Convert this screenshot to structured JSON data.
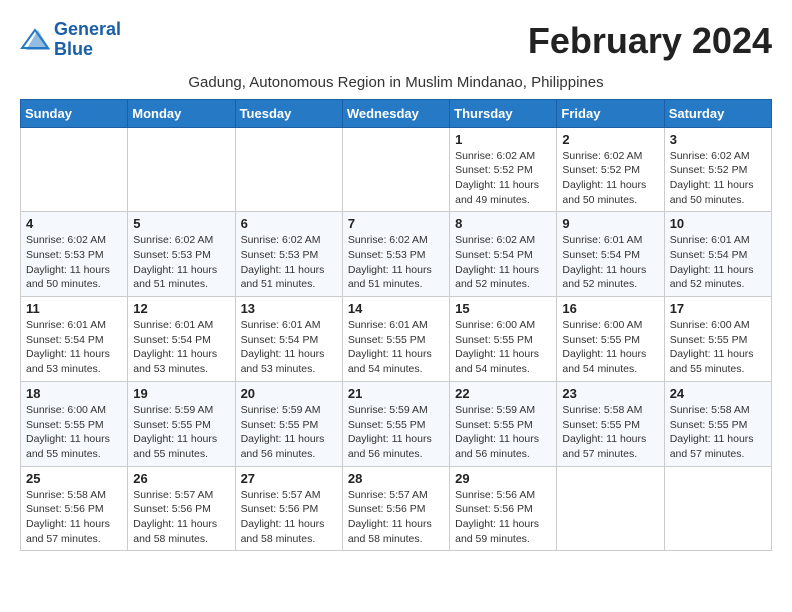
{
  "logo": {
    "line1": "General",
    "line2": "Blue"
  },
  "title": "February 2024",
  "subtitle": "Gadung, Autonomous Region in Muslim Mindanao, Philippines",
  "header": {
    "days": [
      "Sunday",
      "Monday",
      "Tuesday",
      "Wednesday",
      "Thursday",
      "Friday",
      "Saturday"
    ]
  },
  "weeks": [
    [
      {
        "day": "",
        "info": ""
      },
      {
        "day": "",
        "info": ""
      },
      {
        "day": "",
        "info": ""
      },
      {
        "day": "",
        "info": ""
      },
      {
        "day": "1",
        "info": "Sunrise: 6:02 AM\nSunset: 5:52 PM\nDaylight: 11 hours and 49 minutes."
      },
      {
        "day": "2",
        "info": "Sunrise: 6:02 AM\nSunset: 5:52 PM\nDaylight: 11 hours and 50 minutes."
      },
      {
        "day": "3",
        "info": "Sunrise: 6:02 AM\nSunset: 5:52 PM\nDaylight: 11 hours and 50 minutes."
      }
    ],
    [
      {
        "day": "4",
        "info": "Sunrise: 6:02 AM\nSunset: 5:53 PM\nDaylight: 11 hours and 50 minutes."
      },
      {
        "day": "5",
        "info": "Sunrise: 6:02 AM\nSunset: 5:53 PM\nDaylight: 11 hours and 51 minutes."
      },
      {
        "day": "6",
        "info": "Sunrise: 6:02 AM\nSunset: 5:53 PM\nDaylight: 11 hours and 51 minutes."
      },
      {
        "day": "7",
        "info": "Sunrise: 6:02 AM\nSunset: 5:53 PM\nDaylight: 11 hours and 51 minutes."
      },
      {
        "day": "8",
        "info": "Sunrise: 6:02 AM\nSunset: 5:54 PM\nDaylight: 11 hours and 52 minutes."
      },
      {
        "day": "9",
        "info": "Sunrise: 6:01 AM\nSunset: 5:54 PM\nDaylight: 11 hours and 52 minutes."
      },
      {
        "day": "10",
        "info": "Sunrise: 6:01 AM\nSunset: 5:54 PM\nDaylight: 11 hours and 52 minutes."
      }
    ],
    [
      {
        "day": "11",
        "info": "Sunrise: 6:01 AM\nSunset: 5:54 PM\nDaylight: 11 hours and 53 minutes."
      },
      {
        "day": "12",
        "info": "Sunrise: 6:01 AM\nSunset: 5:54 PM\nDaylight: 11 hours and 53 minutes."
      },
      {
        "day": "13",
        "info": "Sunrise: 6:01 AM\nSunset: 5:54 PM\nDaylight: 11 hours and 53 minutes."
      },
      {
        "day": "14",
        "info": "Sunrise: 6:01 AM\nSunset: 5:55 PM\nDaylight: 11 hours and 54 minutes."
      },
      {
        "day": "15",
        "info": "Sunrise: 6:00 AM\nSunset: 5:55 PM\nDaylight: 11 hours and 54 minutes."
      },
      {
        "day": "16",
        "info": "Sunrise: 6:00 AM\nSunset: 5:55 PM\nDaylight: 11 hours and 54 minutes."
      },
      {
        "day": "17",
        "info": "Sunrise: 6:00 AM\nSunset: 5:55 PM\nDaylight: 11 hours and 55 minutes."
      }
    ],
    [
      {
        "day": "18",
        "info": "Sunrise: 6:00 AM\nSunset: 5:55 PM\nDaylight: 11 hours and 55 minutes."
      },
      {
        "day": "19",
        "info": "Sunrise: 5:59 AM\nSunset: 5:55 PM\nDaylight: 11 hours and 55 minutes."
      },
      {
        "day": "20",
        "info": "Sunrise: 5:59 AM\nSunset: 5:55 PM\nDaylight: 11 hours and 56 minutes."
      },
      {
        "day": "21",
        "info": "Sunrise: 5:59 AM\nSunset: 5:55 PM\nDaylight: 11 hours and 56 minutes."
      },
      {
        "day": "22",
        "info": "Sunrise: 5:59 AM\nSunset: 5:55 PM\nDaylight: 11 hours and 56 minutes."
      },
      {
        "day": "23",
        "info": "Sunrise: 5:58 AM\nSunset: 5:55 PM\nDaylight: 11 hours and 57 minutes."
      },
      {
        "day": "24",
        "info": "Sunrise: 5:58 AM\nSunset: 5:55 PM\nDaylight: 11 hours and 57 minutes."
      }
    ],
    [
      {
        "day": "25",
        "info": "Sunrise: 5:58 AM\nSunset: 5:56 PM\nDaylight: 11 hours and 57 minutes."
      },
      {
        "day": "26",
        "info": "Sunrise: 5:57 AM\nSunset: 5:56 PM\nDaylight: 11 hours and 58 minutes."
      },
      {
        "day": "27",
        "info": "Sunrise: 5:57 AM\nSunset: 5:56 PM\nDaylight: 11 hours and 58 minutes."
      },
      {
        "day": "28",
        "info": "Sunrise: 5:57 AM\nSunset: 5:56 PM\nDaylight: 11 hours and 58 minutes."
      },
      {
        "day": "29",
        "info": "Sunrise: 5:56 AM\nSunset: 5:56 PM\nDaylight: 11 hours and 59 minutes."
      },
      {
        "day": "",
        "info": ""
      },
      {
        "day": "",
        "info": ""
      }
    ]
  ]
}
